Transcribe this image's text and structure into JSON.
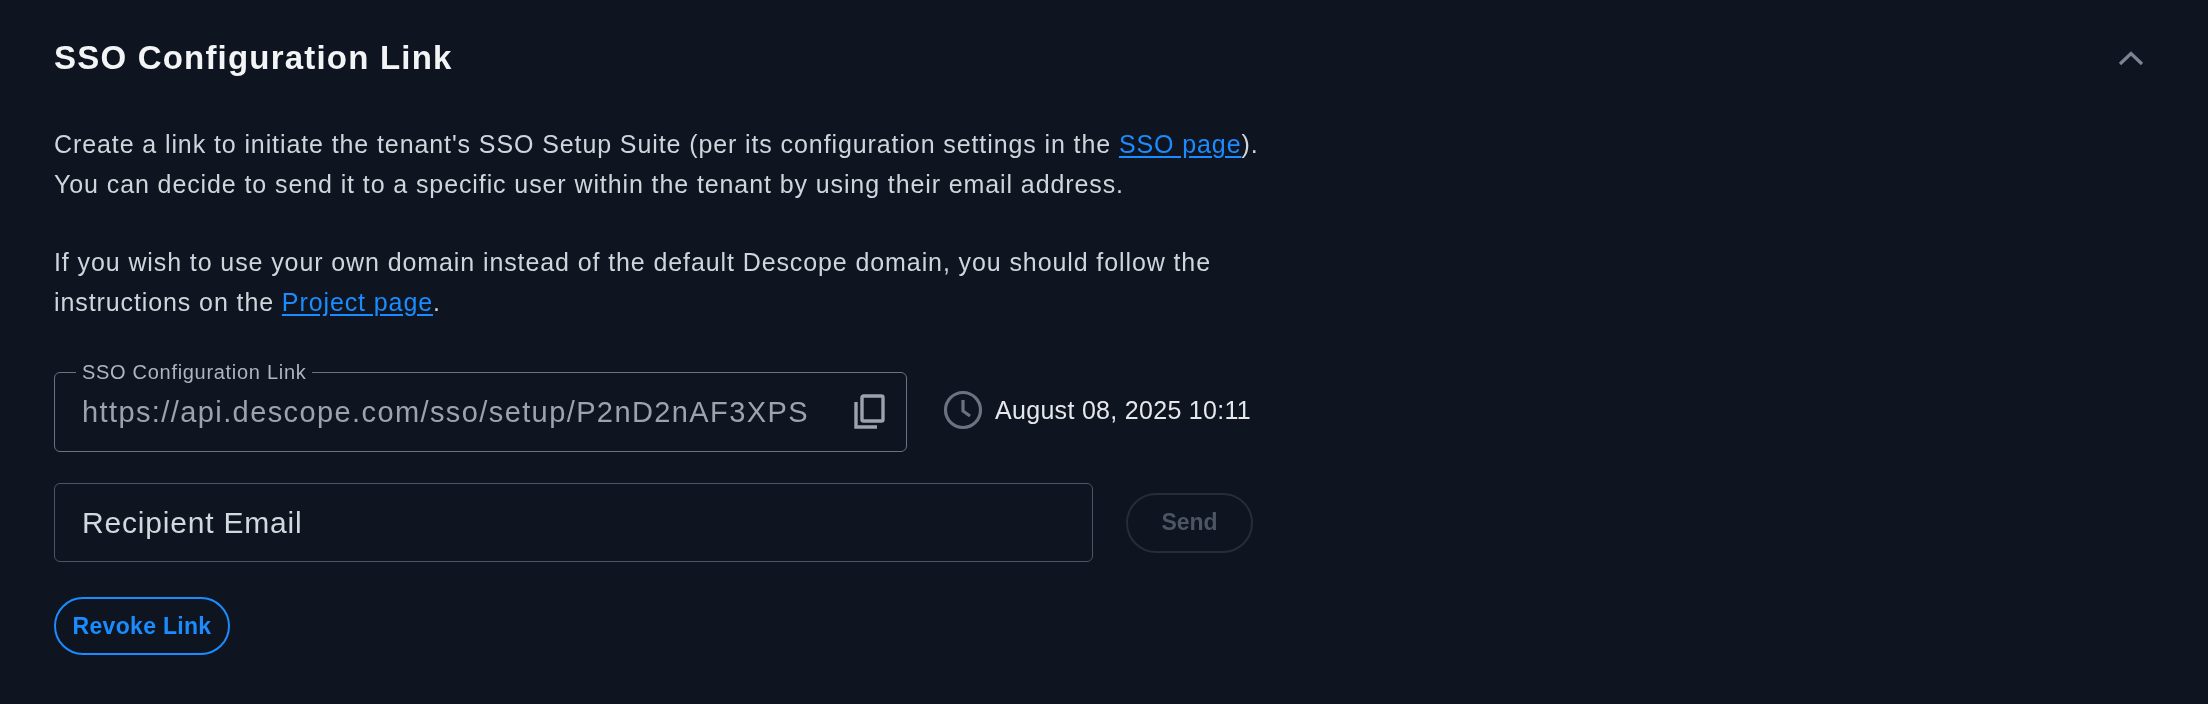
{
  "section": {
    "title": "SSO Configuration Link",
    "expanded": true
  },
  "paragraphs": [
    {
      "segments": [
        {
          "kind": "text",
          "text": "Create a link to initiate the tenant's SSO Setup Suite (per its configuration settings in the "
        },
        {
          "kind": "link",
          "text": "SSO page"
        },
        {
          "kind": "text",
          "text": "). You can decide to send it to a specific user within the tenant by using their email address."
        }
      ]
    },
    {
      "segments": [
        {
          "kind": "text",
          "text": "If you wish to use your own domain instead of the default Descope domain, you should follow the instructions on the "
        },
        {
          "kind": "link",
          "text": "Project page"
        },
        {
          "kind": "text",
          "text": "."
        }
      ]
    }
  ],
  "link_field": {
    "label": "SSO Configuration Link",
    "value": "https://api.descope.com/sso/setup/P2nD2nAF3XPS"
  },
  "created_at": "August 08, 2025 10:11",
  "recipient_field": {
    "placeholder": "Recipient Email"
  },
  "send_button": {
    "label": "Send",
    "disabled": true
  },
  "revoke_button": {
    "label": "Revoke Link"
  }
}
